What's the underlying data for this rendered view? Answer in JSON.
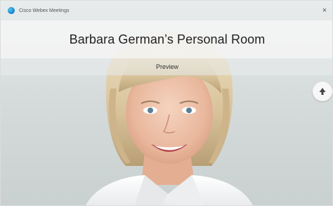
{
  "window": {
    "app_title": "Cisco Webex Meetings",
    "close_label": "×"
  },
  "room": {
    "title": "Barbara German’s Personal Room"
  },
  "preview": {
    "label": "Preview"
  },
  "side_button": {
    "icon": "meeting-info-icon"
  }
}
